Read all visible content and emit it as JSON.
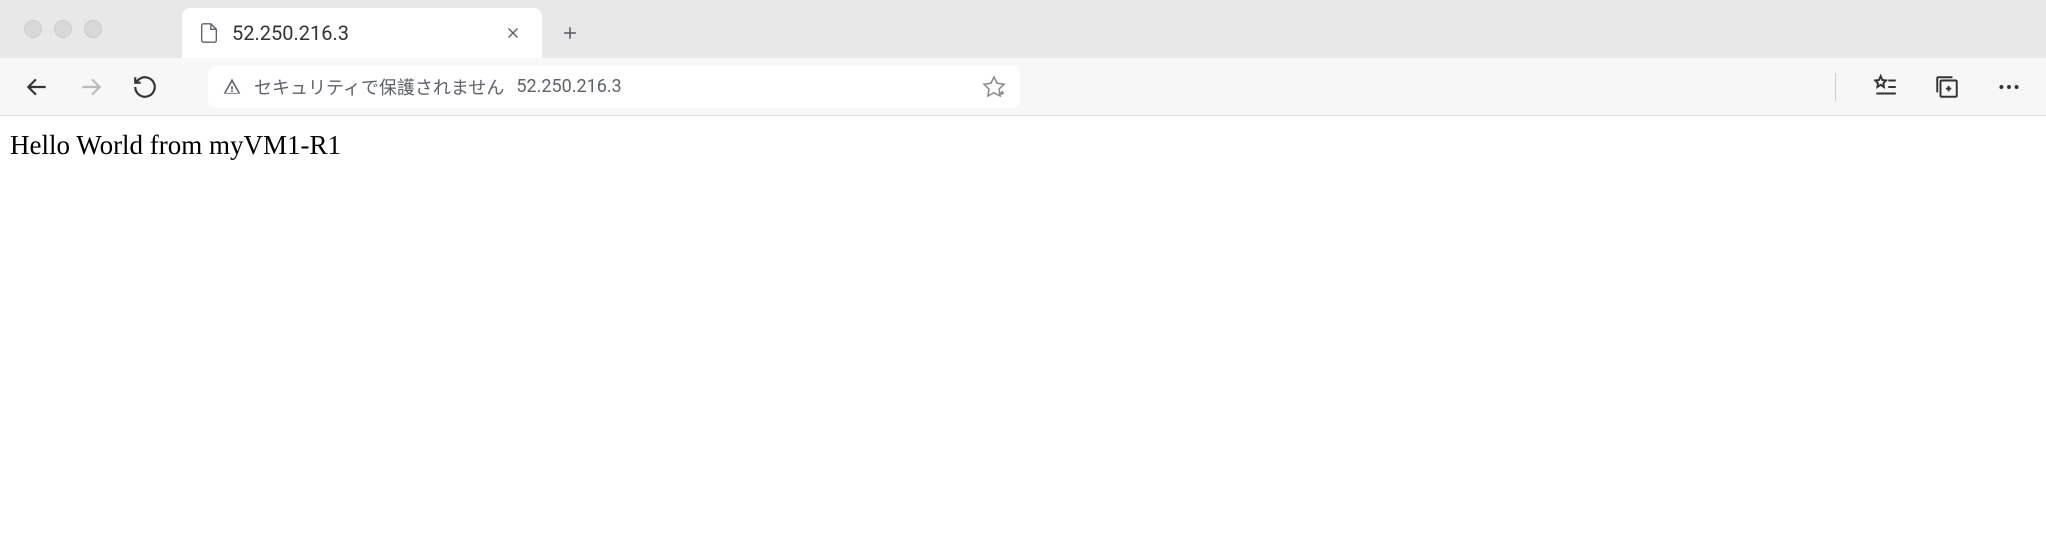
{
  "tab": {
    "title": "52.250.216.3"
  },
  "addressBar": {
    "securityText": "セキュリティで保護されません",
    "url": "52.250.216.3"
  },
  "page": {
    "content": "Hello World from myVM1-R1"
  }
}
